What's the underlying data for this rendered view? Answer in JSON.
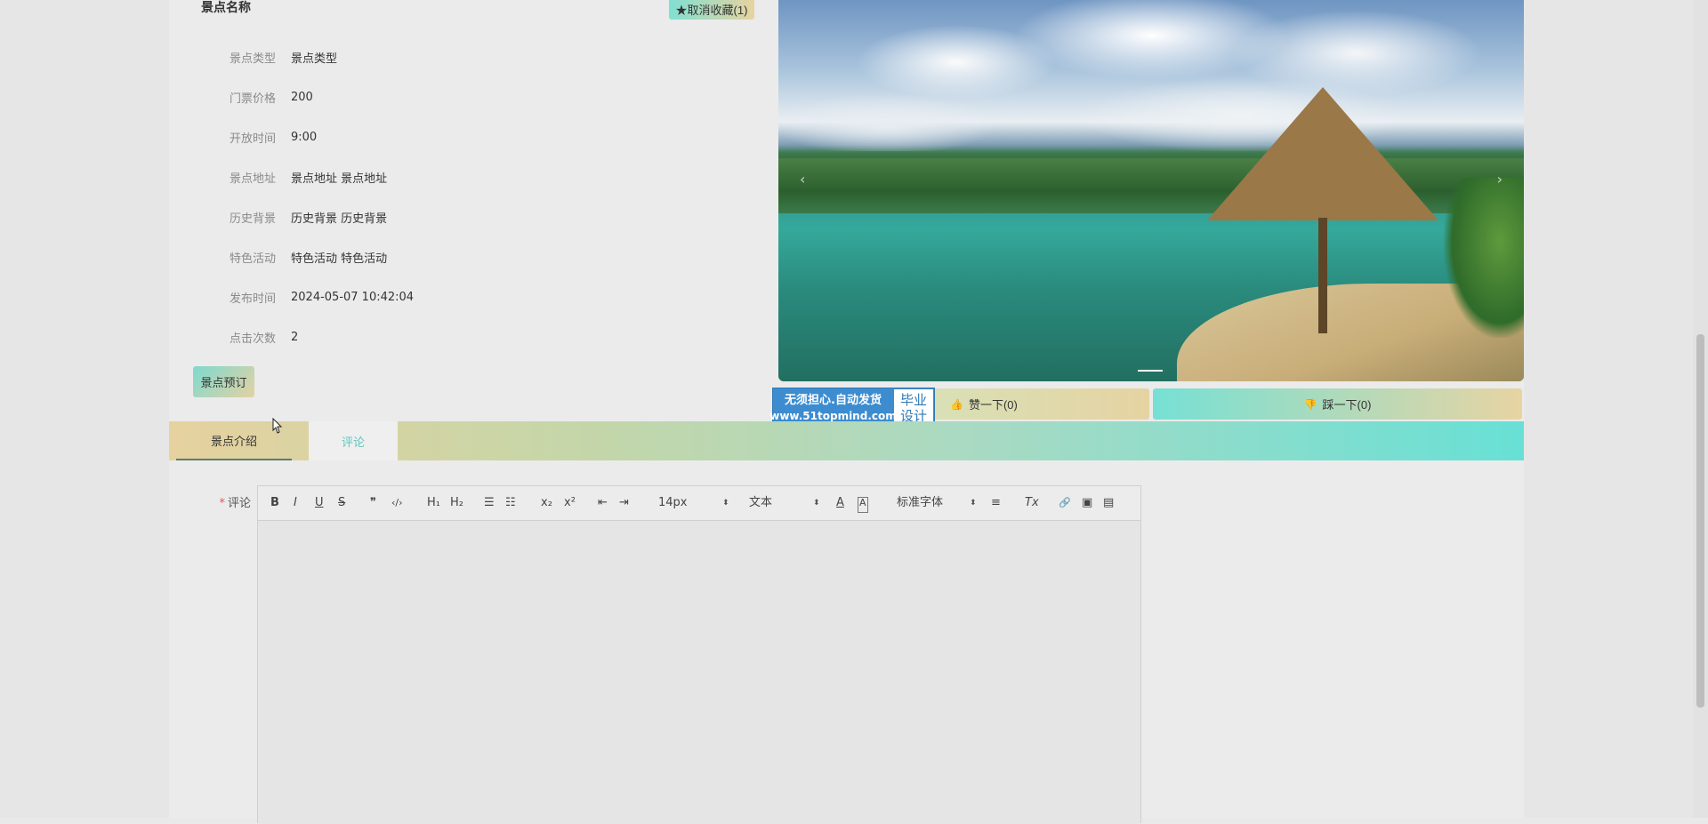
{
  "detail": {
    "title": "景点名称",
    "collect_button": "★取消收藏(1)",
    "rows": [
      {
        "label": "景点类型",
        "value": "景点类型"
      },
      {
        "label": "门票价格",
        "value": "200"
      },
      {
        "label": "开放时间",
        "value": "9:00"
      },
      {
        "label": "景点地址",
        "value": "景点地址 景点地址"
      },
      {
        "label": "历史背景",
        "value": "历史背景 历史背景"
      },
      {
        "label": "特色活动",
        "value": "特色活动 特色活动"
      },
      {
        "label": "发布时间",
        "value": "2024-05-07 10:42:04"
      },
      {
        "label": "点击次数",
        "value": "2"
      }
    ],
    "book_button": "景点预订"
  },
  "carousel": {
    "prev": "‹",
    "next": "›"
  },
  "votes": {
    "like_icon": "👍",
    "like_label": "赞一下(0)",
    "dislike_icon": "👎",
    "dislike_label": "踩一下(0)"
  },
  "badge": {
    "line1": "无须担心.自动发货",
    "line2": "www.51topmind.com",
    "right1": "毕业",
    "right2": "设计"
  },
  "tabs": {
    "intro": "景点介绍",
    "comment": "评论"
  },
  "comment_form": {
    "required_mark": "*",
    "label": "评论",
    "toolbar": {
      "bold": "B",
      "italic": "I",
      "underline": "U",
      "strike": "S",
      "quote": "❞",
      "code": "‹/›",
      "h1": "H₁",
      "h2": "H₂",
      "ordered": "☰",
      "bullet": "☷",
      "sub": "x₂",
      "sup": "x²",
      "outdent": "⇤",
      "indent": "⇥",
      "size": "14px",
      "header": "文本",
      "color": "A",
      "background": "A",
      "font": "标准字体",
      "align": "≡",
      "clean": "Tx",
      "link": "🔗",
      "image": "▣",
      "video": "▤"
    }
  }
}
